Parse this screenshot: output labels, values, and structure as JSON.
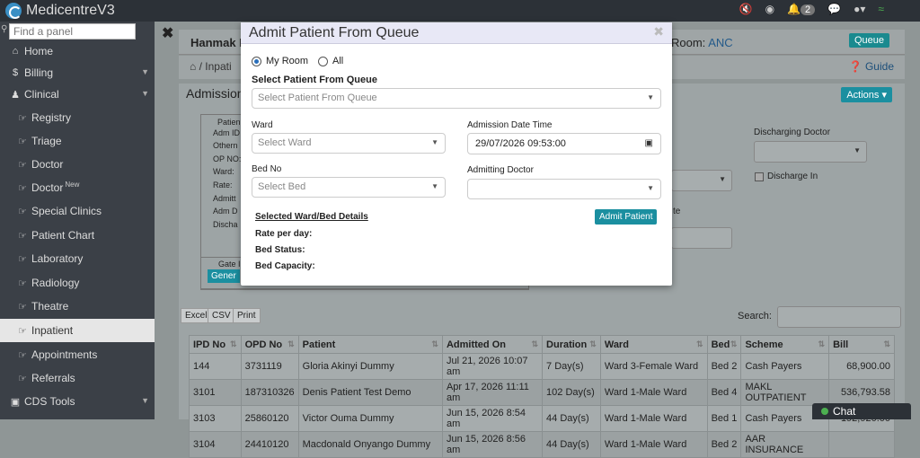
{
  "app": {
    "title": "MedicentreV3",
    "notification_count": "2"
  },
  "sidebar": {
    "search_placeholder": "Find a panel",
    "items": [
      {
        "label": "Home",
        "icon": "home-icon"
      },
      {
        "label": "Billing",
        "icon": "dollar-icon"
      },
      {
        "label": "Clinical",
        "icon": "user-icon"
      },
      {
        "label": "Registry",
        "icon": "hand-icon"
      },
      {
        "label": "Triage",
        "icon": "hand-icon"
      },
      {
        "label": "Doctor",
        "icon": "hand-icon"
      },
      {
        "label": "Doctor",
        "icon": "hand-icon",
        "badge": "New"
      },
      {
        "label": "Special Clinics",
        "icon": "hand-icon"
      },
      {
        "label": "Patient Chart",
        "icon": "hand-icon"
      },
      {
        "label": "Laboratory",
        "icon": "hand-icon"
      },
      {
        "label": "Radiology",
        "icon": "hand-icon"
      },
      {
        "label": "Theatre",
        "icon": "hand-icon"
      },
      {
        "label": "Inpatient",
        "icon": "hand-icon",
        "active": true
      },
      {
        "label": "Appointments",
        "icon": "hand-icon"
      },
      {
        "label": "Referrals",
        "icon": "hand-icon"
      },
      {
        "label": "CDS Tools",
        "icon": "folder-icon"
      }
    ]
  },
  "header": {
    "patient_name": "Hanmak D",
    "room_label": "Room:",
    "room_value": "ANC",
    "queue_label": "Queue"
  },
  "crumb": {
    "text": "Inpati",
    "guide": "Guide"
  },
  "panel": {
    "title": "Admission",
    "actions": "Actions"
  },
  "patient_box": {
    "legend": "Patien",
    "labels": [
      "Adm ID",
      "Othern",
      "OP NO:",
      "Ward:",
      "Rate:",
      "Admitt",
      "Adm D",
      "Discha"
    ]
  },
  "right_fields": {
    "discharging_doctor": "Discharging Doctor",
    "discharge_in": "Discharge In",
    "partial": "te"
  },
  "gate": {
    "legend": "Gate I",
    "button": "Gener"
  },
  "export_buttons": [
    "Excel",
    "CSV",
    "Print"
  ],
  "search_label": "Search:",
  "table": {
    "headers": [
      "IPD No",
      "OPD No",
      "Patient",
      "Admitted On",
      "Duration",
      "Ward",
      "Bed",
      "Scheme",
      "Bill"
    ],
    "rows": [
      [
        "144",
        "3731119",
        "Gloria Akinyi Dummy",
        "Jul 21, 2026 10:07 am",
        "7 Day(s)",
        "Ward 3-Female Ward",
        "Bed 2",
        "Cash Payers",
        "68,900.00"
      ],
      [
        "3101",
        "187310326",
        "Denis Patient Test Demo",
        "Apr 17, 2026 11:11 am",
        "102 Day(s)",
        "Ward 1-Male Ward",
        "Bed 4",
        "MAKL OUTPATIENT",
        "536,793.58"
      ],
      [
        "3103",
        "25860120",
        "Victor Ouma Dummy",
        "Jun 15, 2026 8:54 am",
        "44 Day(s)",
        "Ward 1-Male Ward",
        "Bed 1",
        "Cash Payers",
        "192,920.00"
      ],
      [
        "3104",
        "24410120",
        "Macdonald Onyango Dummy",
        "Jun 15, 2026 8:56 am",
        "44 Day(s)",
        "Ward 1-Male Ward",
        "Bed 2",
        "AAR INSURANCE",
        ""
      ]
    ]
  },
  "chat": {
    "label": "Chat"
  },
  "modal": {
    "title": "Admit Patient From Queue",
    "radio_myroom": "My Room",
    "radio_all": "All",
    "select_patient_label": "Select Patient From Queue",
    "select_patient_placeholder": "Select Patient From Queue",
    "ward_label": "Ward",
    "ward_placeholder": "Select Ward",
    "admission_dt_label": "Admission Date Time",
    "admission_dt_value": "29/07/2026 09:53:00",
    "bed_label": "Bed No",
    "bed_placeholder": "Select Bed",
    "admitting_doctor_label": "Admitting Doctor",
    "selected_details": "Selected Ward/Bed Details",
    "admit_button": "Admit Patient",
    "rate_label": "Rate per day:",
    "bed_status_label": "Bed Status:",
    "bed_capacity_label": "Bed Capacity:"
  }
}
